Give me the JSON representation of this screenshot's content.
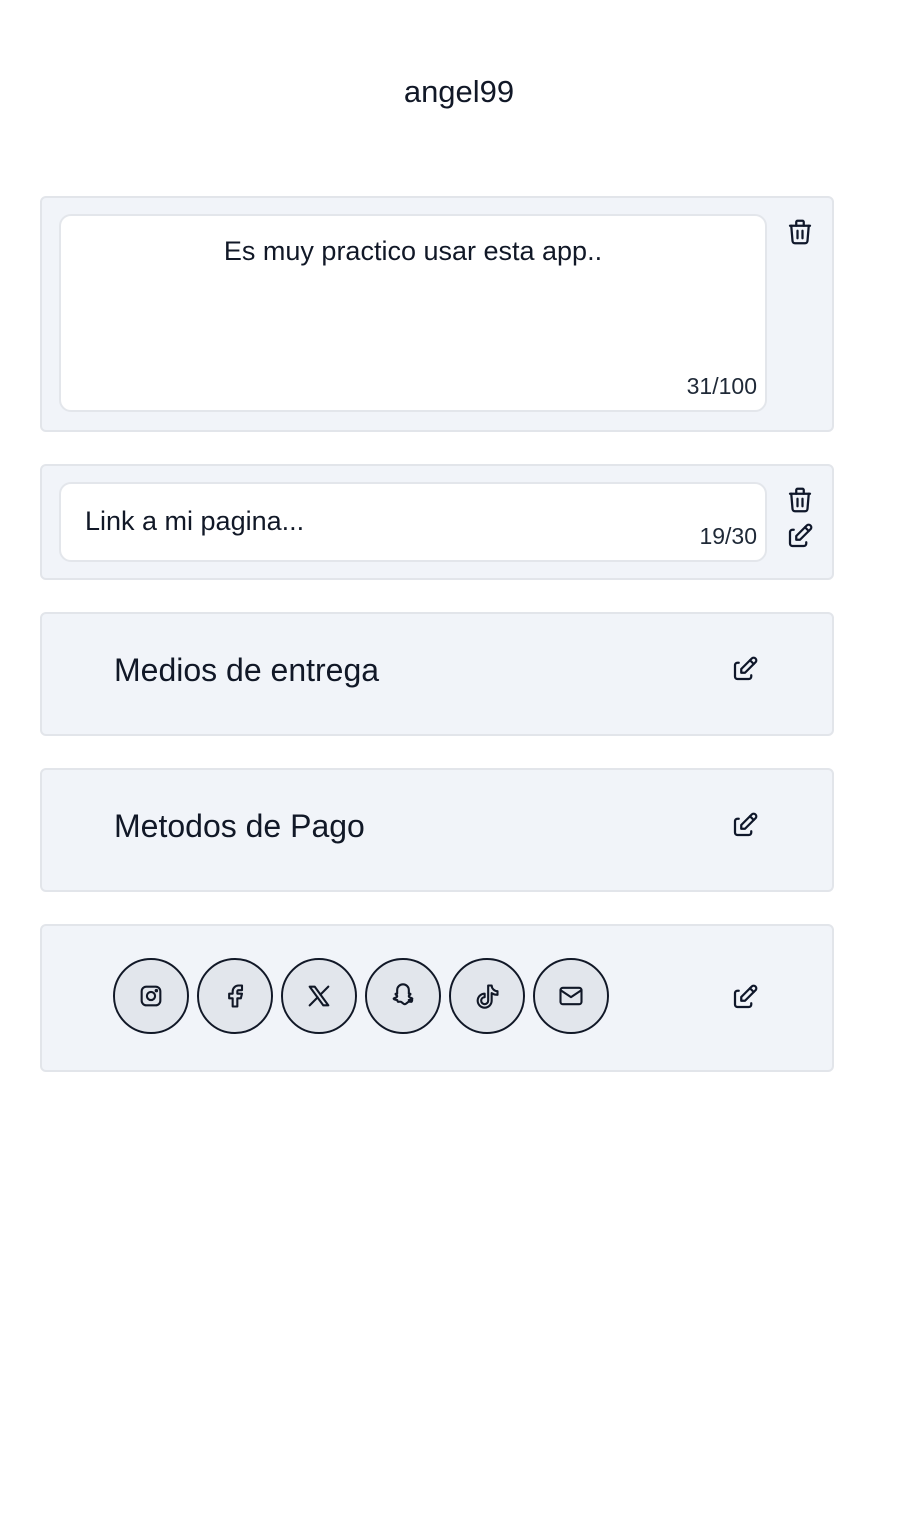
{
  "profile": {
    "username": "angel99"
  },
  "bio": {
    "text": "Es muy practico usar esta app..",
    "counter": "31/100"
  },
  "link": {
    "text": "Link a mi pagina...",
    "counter": "19/30"
  },
  "sections": {
    "entrega_label": "Medios de entrega",
    "pago_label": "Metodos de Pago"
  },
  "social": {
    "icons": [
      "instagram-icon",
      "facebook-icon",
      "x-icon",
      "snapchat-icon",
      "tiktok-icon",
      "mail-icon"
    ]
  },
  "colors": {
    "card_bg": "#f1f4f9",
    "card_border": "#e2e5ea",
    "social_btn_bg": "#e2e6ec",
    "text": "#111827"
  }
}
